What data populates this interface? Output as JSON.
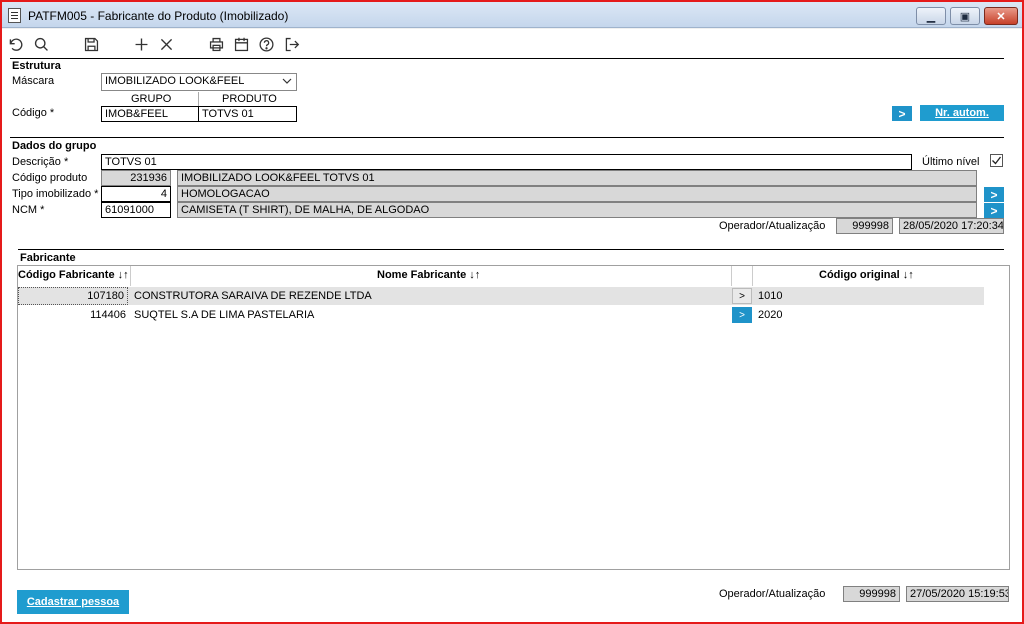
{
  "window": {
    "title": "PATFM005 - Fabricante do Produto (Imobilizado)",
    "minimize_glyph": "▁",
    "restore_glyph": "▣",
    "close_glyph": "✕"
  },
  "toolbar": {
    "icons": [
      "undo-icon",
      "search-icon",
      "save-icon",
      "add-icon",
      "close-icon",
      "print-icon",
      "calendar-icon",
      "help-icon",
      "exit-icon"
    ]
  },
  "estrutura": {
    "heading": "Estrutura",
    "mascara_label": "Máscara",
    "mascara_value": "IMOBILIZADO LOOK&FEEL",
    "grupo_header": "GRUPO",
    "produto_header": "PRODUTO",
    "codigo_label": "Código *",
    "codigo_grupo": "IMOB&FEEL",
    "codigo_produto": "TOTVS 01",
    "go_glyph": ">",
    "nr_autom_label": "Nr. autom."
  },
  "dados": {
    "heading": "Dados do grupo",
    "descricao_label": "Descrição *",
    "descricao_value": "TOTVS 01",
    "ultimo_nivel_label": "Último nível",
    "ultimo_nivel_checked": true,
    "codigo_produto_label": "Código produto",
    "codigo_produto_num": "231936",
    "codigo_produto_desc": "IMOBILIZADO LOOK&FEEL TOTVS 01",
    "tipo_label": "Tipo imobilizado *",
    "tipo_num": "4",
    "tipo_desc": "HOMOLOGACAO",
    "ncm_label": "NCM *",
    "ncm_num": "61091000",
    "ncm_desc": "CAMISETA (T SHIRT), DE MALHA, DE ALGODAO",
    "operador_label": "Operador/Atualização",
    "operador_value": "999998",
    "atualizacao_value": "28/05/2020 17:20:34",
    "go_glyph": ">"
  },
  "fabricante": {
    "heading": "Fabricante",
    "columns": [
      "Código Fabricante ↓↑",
      "Nome Fabricante ↓↑",
      "Código original ↓↑"
    ],
    "rows": [
      {
        "codigo": "107180",
        "nome": "CONSTRUTORA SARAIVA DE REZENDE LTDA",
        "btn": ">",
        "original": "1010"
      },
      {
        "codigo": "114406",
        "nome": "SUQTEL S.A DE LIMA PASTELARIA",
        "btn": ">",
        "original": "2020"
      }
    ]
  },
  "footer": {
    "cadastrar_label": "Cadastrar pessoa",
    "operador_label": "Operador/Atualização",
    "operador_value": "999998",
    "atualizacao_value": "27/05/2020 15:19:53"
  },
  "colors": {
    "accent": "#1f93c9",
    "frame_border": "#e51a1a",
    "readonly_bg": "#d8d8d8"
  }
}
